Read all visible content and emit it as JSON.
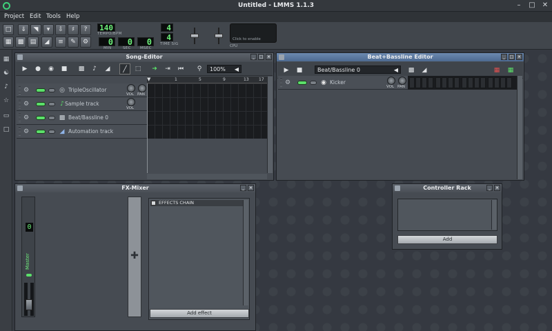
{
  "window": {
    "title": "Untitled - LMMS 1.1.3",
    "buttons": [
      "–",
      "□",
      "✕"
    ]
  },
  "menu": {
    "items": [
      "Project",
      "Edit",
      "Tools",
      "Help"
    ]
  },
  "toolbar": {
    "tempo_value": "140",
    "tempo_label": "TEMPO/BPM",
    "time_min": "0",
    "time_sec": "0",
    "time_msec": "0",
    "min_label": "MIN",
    "sec_label": "SEC",
    "msec_label": "MSEC",
    "timesig_num": "4",
    "timesig_den": "4",
    "timesig_label": "TIME SIG",
    "cpu_text": "Click to enable",
    "cpu_label": "CPU"
  },
  "song_editor": {
    "title": "Song-Editor",
    "zoom": "100%",
    "ruler": [
      "1",
      "5",
      "9",
      "13",
      "17"
    ],
    "tracks": [
      {
        "name": "TripleOscillator",
        "icon": "synth-icon",
        "knobs": [
          "VOL",
          "PAN"
        ]
      },
      {
        "name": "Sample track",
        "icon": "note-icon",
        "knobs": [
          "VOL"
        ]
      },
      {
        "name": "Beat/Bassline 0",
        "icon": "beat-icon",
        "knobs": []
      },
      {
        "name": "Automation track",
        "icon": "automation-icon",
        "knobs": []
      }
    ]
  },
  "bb_editor": {
    "title": "Beat+Bassline Editor",
    "pattern": "Beat/Bassline 0",
    "tracks": [
      {
        "name": "Kicker",
        "knobs": [
          "VOL",
          "PAN"
        ],
        "steps": 16
      }
    ]
  },
  "fx_mixer": {
    "title": "FX-Mixer",
    "channel_number": "0",
    "master_label": "Master",
    "effects_chain_label": "EFFECTS CHAIN",
    "add_effect": "Add effect"
  },
  "controller_rack": {
    "title": "Controller Rack",
    "add": "Add"
  },
  "colors": {
    "led_on": "#5be06a",
    "lcd_text": "#6df07a",
    "active_title": "#5a77a0"
  }
}
